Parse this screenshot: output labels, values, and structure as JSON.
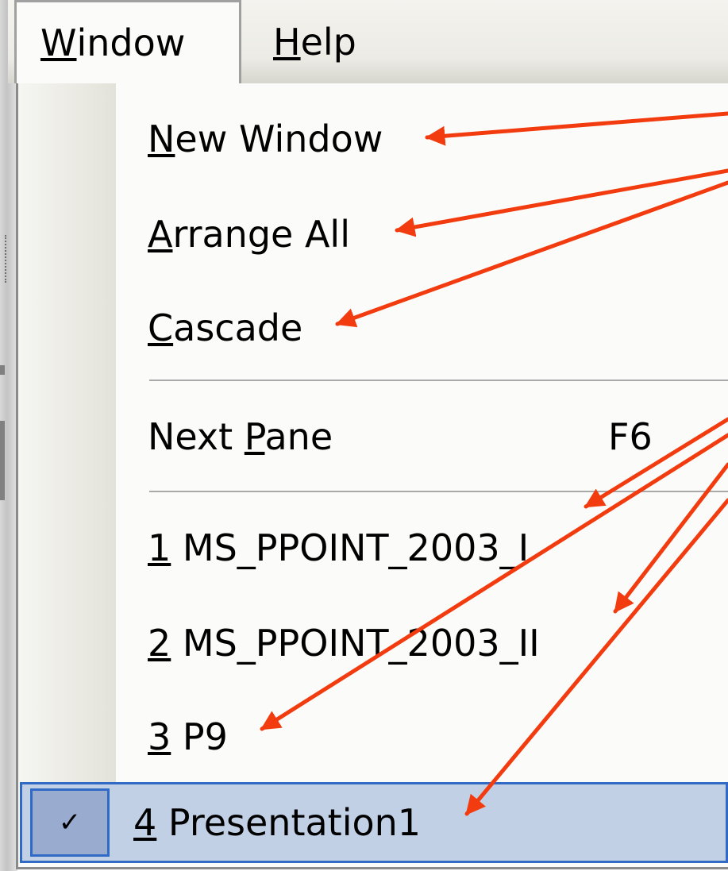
{
  "menubar": {
    "items": [
      {
        "pre": "",
        "ul": "W",
        "post": "indow"
      },
      {
        "pre": "",
        "ul": "H",
        "post": "elp"
      }
    ]
  },
  "window_menu": {
    "items": [
      {
        "pre": "",
        "ul": "N",
        "post": "ew Window"
      },
      {
        "pre": "",
        "ul": "A",
        "post": "rrange All"
      },
      {
        "pre": "",
        "ul": "C",
        "post": "ascade"
      },
      {
        "pre": "Next ",
        "ul": "P",
        "post": "ane",
        "shortcut": "F6"
      },
      {
        "pre": "",
        "ul": "1",
        "post": " MS_PPOINT_2003_I"
      },
      {
        "pre": "",
        "ul": "2",
        "post": " MS_PPOINT_2003_II"
      },
      {
        "pre": "",
        "ul": "3",
        "post": " P9"
      }
    ],
    "active_item": {
      "pre": "",
      "ul": "4",
      "post": " Presentation1",
      "checked": true,
      "check_glyph": "✓"
    }
  },
  "colors": {
    "arrow": "#f23b0e",
    "highlight": "#c2d0e6",
    "highlight_border": "#316ac5"
  }
}
